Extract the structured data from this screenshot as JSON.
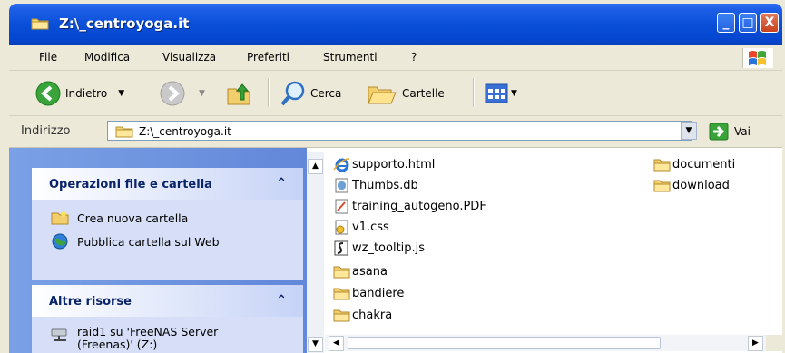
{
  "window": {
    "title": "Z:\\_centroyoga.it",
    "minimize": "_",
    "maximize": "□",
    "close": "X"
  },
  "menu": [
    "File",
    "Modifica",
    "Visualizza",
    "Preferiti",
    "Strumenti",
    "?"
  ],
  "toolbar": {
    "back": "Indietro",
    "search": "Cerca",
    "folders": "Cartelle"
  },
  "address": {
    "label": "Indirizzo",
    "value": "Z:\\_centroyoga.it",
    "go": "Vai"
  },
  "tasks": {
    "file_folder": {
      "title": "Operazioni file e cartella",
      "items": [
        "Crea nuova cartella",
        "Pubblica cartella sul Web"
      ]
    },
    "other": {
      "title": "Altre risorse",
      "items": [
        "raid1 su 'FreeNAS Server (Freenas)' (Z:)"
      ]
    }
  },
  "files": [
    {
      "name": "supporto.html",
      "icon": "ie-html-icon"
    },
    {
      "name": "Thumbs.db",
      "icon": "db-file-icon"
    },
    {
      "name": "training_autogeno.PDF",
      "icon": "pdf-file-icon"
    },
    {
      "name": "v1.css",
      "icon": "css-file-icon"
    },
    {
      "name": "wz_tooltip.js",
      "icon": "script-file-icon"
    },
    {
      "name": "asana",
      "icon": "folder-icon"
    },
    {
      "name": "bandiere",
      "icon": "folder-icon"
    },
    {
      "name": "chakra",
      "icon": "folder-icon"
    },
    {
      "name": "documenti",
      "icon": "folder-icon"
    },
    {
      "name": "download",
      "icon": "folder-icon"
    }
  ],
  "colors": {
    "titlebar": "#0a4fd8",
    "taskpane": "#6d90dc",
    "panel_title": "#0a246a"
  }
}
